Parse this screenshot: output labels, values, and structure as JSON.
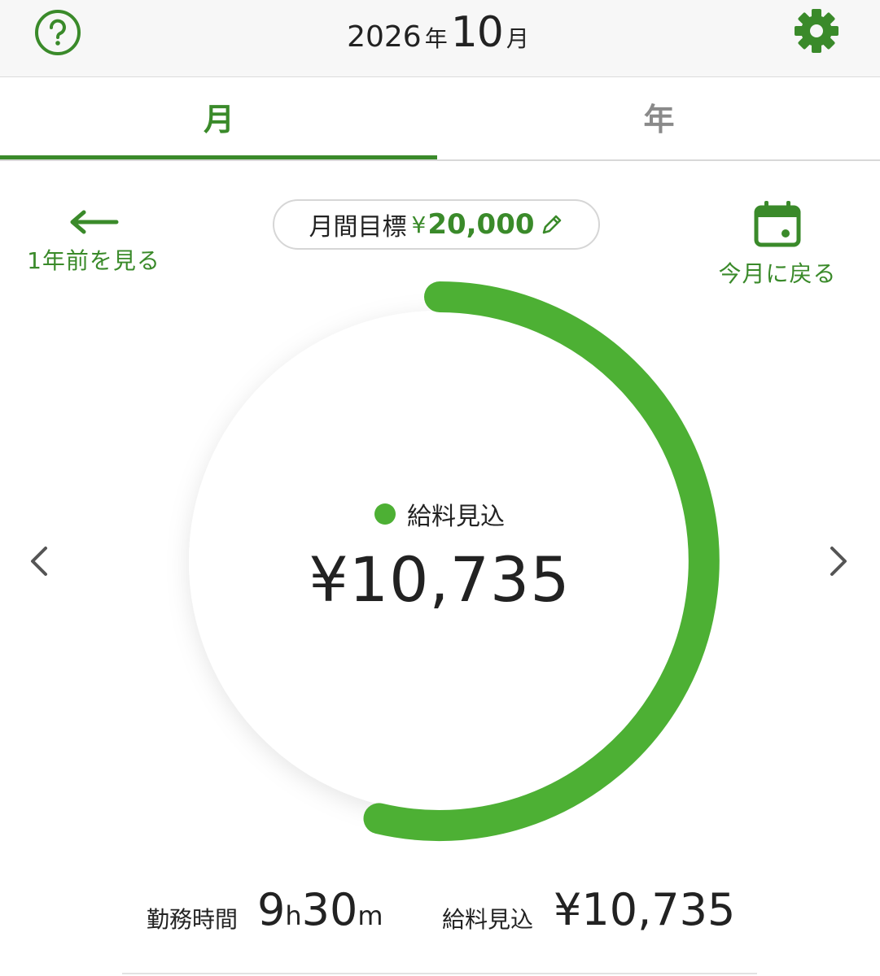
{
  "header": {
    "year": "2026",
    "year_unit": "年",
    "month": "10",
    "month_unit": "月",
    "help_icon": "question-circle-icon",
    "settings_icon": "gear-icon"
  },
  "tabs": [
    {
      "label": "月",
      "active": true
    },
    {
      "label": "年",
      "active": false
    }
  ],
  "nav": {
    "prev_year_label": "1年前を見る",
    "this_month_label": "今月に戻る"
  },
  "goal": {
    "label": "月間目標",
    "currency": "¥",
    "value": "20,000"
  },
  "ring": {
    "legend": "給料見込",
    "amount": "¥10,735",
    "progress": 0.5368,
    "color": "#4db034"
  },
  "summary": {
    "hours_label": "勤務時間",
    "hours_h": "9",
    "hours_h_unit": "h",
    "hours_m": "30",
    "hours_m_unit": "m",
    "pay_label": "給料見込",
    "pay_value": "¥10,735"
  },
  "colors": {
    "accent": "#3a8a2a",
    "ring": "#4db034",
    "inactive": "#8a8a8a"
  }
}
